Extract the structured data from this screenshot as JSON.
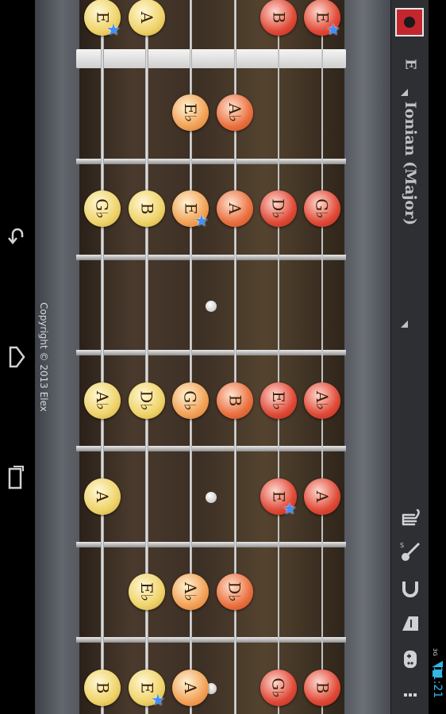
{
  "copyright": "Copyright © 2013 Elex",
  "key_label": "E",
  "scale_label": "Ionian (Major)",
  "clock": "11:21",
  "signal_label": "3G",
  "notes": [
    [
      "E",
      "A",
      "",
      "",
      "B",
      "E"
    ],
    [
      "",
      "",
      "E♭",
      "A♭",
      "",
      ""
    ],
    [
      "G♭",
      "B",
      "E",
      "A",
      "D♭",
      "G♭"
    ],
    [
      "",
      "",
      "",
      "",
      "",
      ""
    ],
    [
      "A♭",
      "D♭",
      "G♭",
      "B",
      "E♭",
      "A♭"
    ],
    [
      "A",
      "",
      "",
      "",
      "E",
      "A"
    ],
    [
      "",
      "E♭",
      "A♭",
      "D♭",
      "",
      ""
    ],
    [
      "B",
      "E",
      "A",
      "",
      "G♭",
      "B"
    ]
  ],
  "icons": {
    "back": "back-arrow-icon",
    "home": "home-icon",
    "recent": "recent-apps-icon",
    "record": "record-icon",
    "hand": "hand-icon",
    "guitar": "guitar-icon",
    "magnet": "magnet-icon",
    "tuner": "tuner-icon",
    "gamepad": "gamepad-icon",
    "menu": "menu-icon"
  },
  "colors": {
    "accent_blue": "#3f8fff",
    "record_red": "#c4262e",
    "clock_blue": "#33b5e5"
  }
}
